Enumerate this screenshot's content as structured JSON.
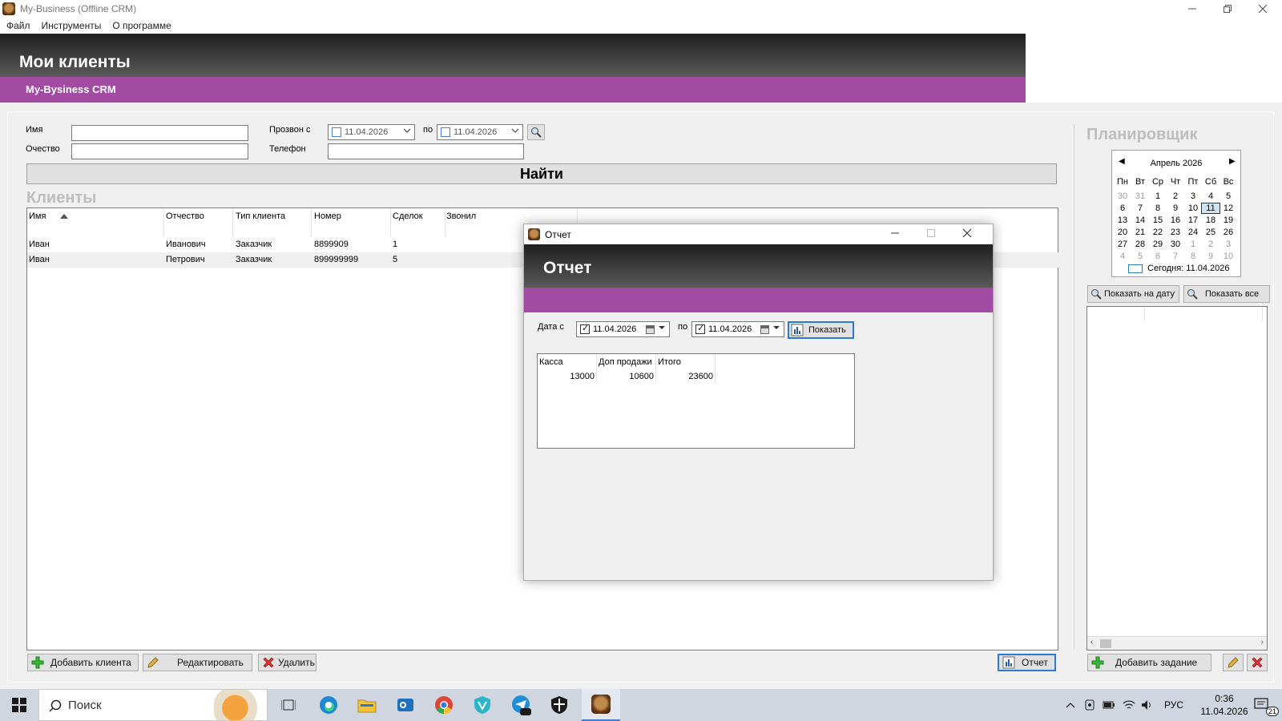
{
  "window": {
    "title": "My-Business (Offline CRM)",
    "controls": [
      "minimize-icon",
      "restore-icon",
      "close-icon"
    ]
  },
  "menu": [
    "Файл",
    "Инструменты",
    "О программе"
  ],
  "header": {
    "title": "Мои клиенты",
    "subtitle": "My-Bysiness CRM"
  },
  "filters": {
    "name_label": "Имя",
    "name_value": "",
    "patronymic_label": "Очество",
    "patronymic_value": "",
    "call_from_label": "Прозвон с",
    "call_from_date": "11.04.2026",
    "call_to_label": "по",
    "call_to_date": "11.04.2026",
    "phone_label": "Телефон",
    "phone_value": "",
    "find_label": "Найти"
  },
  "clients": {
    "section_title": "Клиенты",
    "columns": [
      "Имя",
      "Отчество",
      "Тип клиента",
      "Номер",
      "Сделок",
      "Звонил"
    ],
    "rows": [
      [
        "Иван",
        "Иванович",
        "Заказчик",
        "8899909",
        "1",
        ""
      ],
      [
        "Иван",
        "Петрович",
        "Заказчик",
        "899999999",
        "5",
        ""
      ]
    ]
  },
  "actions": {
    "add_client": "Добавить клиента",
    "edit": "Редактировать",
    "delete": "Удалить",
    "report": "Отчет"
  },
  "planner": {
    "title": "Планировщик",
    "calendar": {
      "month": "Апрель 2026",
      "weekdays": [
        "Пн",
        "Вт",
        "Ср",
        "Чт",
        "Пт",
        "Сб",
        "Вс"
      ],
      "weeks": [
        [
          "30",
          "31",
          "1",
          "2",
          "3",
          "4",
          "5"
        ],
        [
          "6",
          "7",
          "8",
          "9",
          "10",
          "11",
          "12"
        ],
        [
          "13",
          "14",
          "15",
          "16",
          "17",
          "18",
          "19"
        ],
        [
          "20",
          "21",
          "22",
          "23",
          "24",
          "25",
          "26"
        ],
        [
          "27",
          "28",
          "29",
          "30",
          "1",
          "2",
          "3"
        ],
        [
          "4",
          "5",
          "6",
          "7",
          "8",
          "9",
          "10"
        ]
      ],
      "today_label": "Сегодня: 11.04.2026",
      "selected_day": "11"
    },
    "show_on_date": "Показать на дату",
    "show_all": "Показать все",
    "add_task": "Добавить задание"
  },
  "report_dialog": {
    "window_title": "Отчет",
    "header": "Отчет",
    "date_from_label": "Дата с",
    "date_from": "11.04.2026",
    "date_to_label": "по",
    "date_to": "11.04.2026",
    "show_label": "Показать",
    "columns": [
      "Касса",
      "Доп продажи",
      "Итого"
    ],
    "values": [
      "13000",
      "10600",
      "23600"
    ]
  },
  "taskbar": {
    "search_placeholder": "Поиск",
    "language": "РУС",
    "time": "0:36",
    "date": "11.04.2026",
    "notifications": "21"
  },
  "colors": {
    "accent_purple": "#a14ba2",
    "header_dark": "#2b2b2b",
    "focus_blue": "#2a7ad4"
  }
}
